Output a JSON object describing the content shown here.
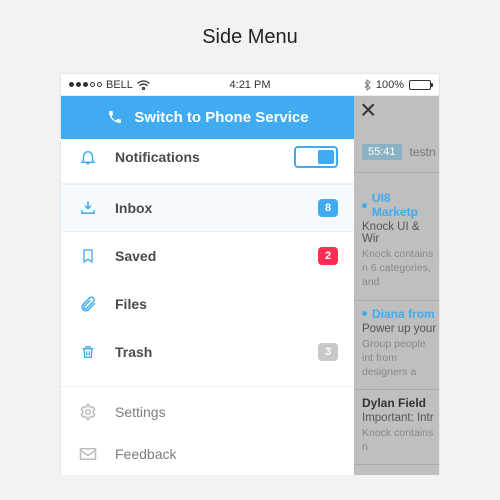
{
  "page_title": "Side Menu",
  "status": {
    "carrier": "BELL",
    "time": "4:21 PM",
    "battery_pct": "100%"
  },
  "cta_label": "Switch to Phone Service",
  "menu": {
    "notifications": {
      "label": "Notifications",
      "toggled": true
    },
    "items": [
      {
        "icon": "inbox",
        "label": "Inbox",
        "badge": "8",
        "badge_cls": "blue",
        "selected": true
      },
      {
        "icon": "bookmark",
        "label": "Saved",
        "badge": "2",
        "badge_cls": "red"
      },
      {
        "icon": "paperclip",
        "label": "Files"
      },
      {
        "icon": "trash",
        "label": "Trash",
        "badge": "3",
        "badge_cls": "gray"
      }
    ],
    "footer": [
      {
        "icon": "gear",
        "label": "Settings"
      },
      {
        "icon": "envelope",
        "label": "Feedback"
      }
    ]
  },
  "content": {
    "timestamp": "55:41",
    "user": "testn",
    "items": [
      {
        "unread": true,
        "title": "UI8 Marketp",
        "sub": "Knock UI & Wir",
        "body": "Knock contains n\n6 categories, and"
      },
      {
        "unread": true,
        "title": "Diana from ",
        "sub": "Power up your",
        "body": "Group people int\nfrom designers a"
      },
      {
        "unread": false,
        "title": "Dylan Field",
        "sub": "Important: Intr",
        "body": "Knock contains n"
      }
    ]
  }
}
